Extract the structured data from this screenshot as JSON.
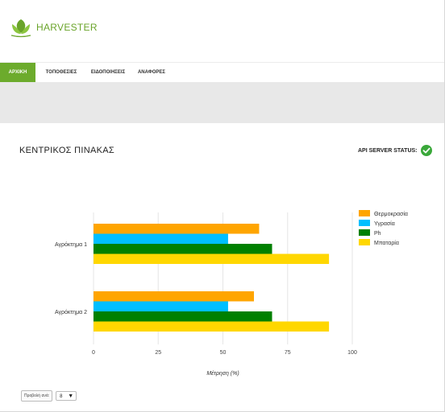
{
  "brand": {
    "name": "HARVESTER",
    "color": "#6aa42a"
  },
  "nav": {
    "items": [
      {
        "label": "ΑΡΧΙΚΗ",
        "active": true
      },
      {
        "label": "ΤΟΠΟΘΕΣΙΕΣ",
        "active": false
      },
      {
        "label": "ΕΙΔΟΠΟΙΗΣΕΙΣ",
        "active": false
      },
      {
        "label": "ΑΝΑΦΟΡΕΣ",
        "active": false
      }
    ],
    "active_color": "#6cab2c"
  },
  "page": {
    "title": "ΚΕΝΤΡΙΚΟΣ ΠΙΝΑΚΑΣ",
    "api_status_label": "API SERVER STATUS:",
    "api_status_icon": "check-circle-icon",
    "api_status_color": "#3aa83a"
  },
  "chart_data": {
    "type": "bar",
    "orientation": "horizontal",
    "categories": [
      "Αγρόκτημα 1",
      "Αγρόκτημα 2"
    ],
    "series": [
      {
        "name": "Θερμοκρασία",
        "color": "#ffa500",
        "values": [
          64,
          62
        ]
      },
      {
        "name": "Υγρασία",
        "color": "#00bfff",
        "values": [
          52,
          52
        ]
      },
      {
        "name": "Ph",
        "color": "#008000",
        "values": [
          69,
          69
        ]
      },
      {
        "name": "Μπαταρία",
        "color": "#ffd700",
        "values": [
          91,
          91
        ]
      }
    ],
    "xlabel": "Μέτρηση (%)",
    "xlim": [
      0,
      100
    ],
    "xticks": [
      0,
      25,
      50,
      75,
      100
    ],
    "grid": true,
    "legend": "right"
  },
  "pager": {
    "label": "Προβολή ανά:",
    "value": "8"
  }
}
